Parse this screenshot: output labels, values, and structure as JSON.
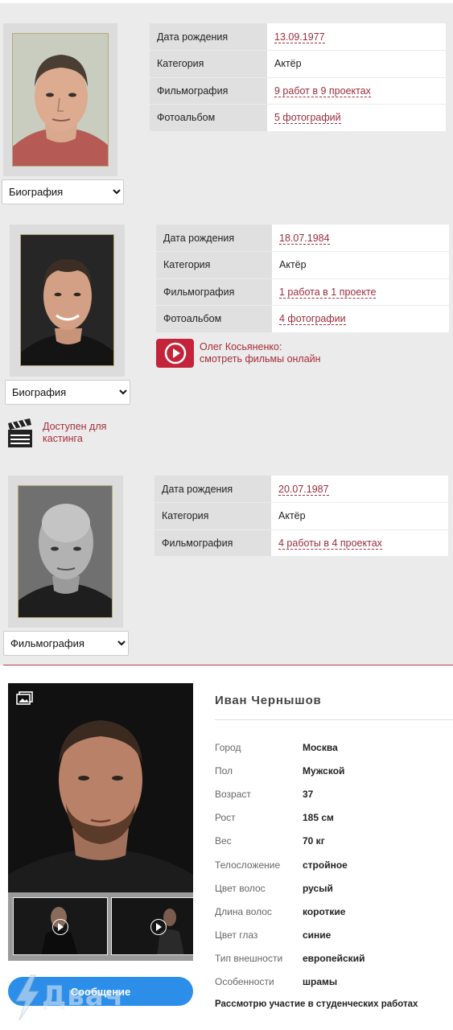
{
  "actors": [
    {
      "dropdown": "Биография",
      "rows": [
        {
          "label": "Дата рождения",
          "value": "13.09.1977",
          "link": true
        },
        {
          "label": "Категория",
          "value": "Актёр",
          "link": false
        },
        {
          "label": "Фильмография",
          "value": "9 работ в 9 проектах",
          "link": true
        },
        {
          "label": "Фотоальбом",
          "value": "5 фотографий",
          "link": true
        }
      ]
    },
    {
      "dropdown": "Биография",
      "rows": [
        {
          "label": "Дата рождения",
          "value": "18.07.1984",
          "link": true
        },
        {
          "label": "Категория",
          "value": "Актёр",
          "link": false
        },
        {
          "label": "Фильмография",
          "value": "1 работа в 1 проекте",
          "link": true
        },
        {
          "label": "Фотоальбом",
          "value": "4 фотографии",
          "link": true
        }
      ],
      "watch_line1": "Олег Косьяненко:",
      "watch_line2": "смотреть фильмы онлайн",
      "casting_line1": "Доступен для",
      "casting_line2": "кастинга"
    },
    {
      "dropdown": "Фильмография",
      "rows": [
        {
          "label": "Дата рождения",
          "value": "20.07.1987",
          "link": true
        },
        {
          "label": "Категория",
          "value": "Актёр",
          "link": false
        },
        {
          "label": "Фильмография",
          "value": "4 работы в 4 проектах",
          "link": true
        }
      ]
    }
  ],
  "profile": {
    "name": "Иван Чернышов",
    "props": [
      {
        "label": "Город",
        "value": "Москва"
      },
      {
        "label": "Пол",
        "value": "Мужской"
      },
      {
        "label": "Возраст",
        "value": "37"
      },
      {
        "label": "Рост",
        "value": "185 см"
      },
      {
        "label": "Вес",
        "value": "70 кг"
      },
      {
        "label": "Телосложение",
        "value": "стройное"
      },
      {
        "label": "Цвет волос",
        "value": "русый"
      },
      {
        "label": "Длина волос",
        "value": "короткие"
      },
      {
        "label": "Цвет глаз",
        "value": "синие"
      },
      {
        "label": "Тип внешности",
        "value": "европейский"
      },
      {
        "label": "Особенности",
        "value": "шрамы"
      }
    ],
    "student_note": "Рассмотрю участие в студенческих работах",
    "message_button": "Сообщение"
  },
  "watermark": "Двач",
  "colors": {
    "link": "#9b2b39",
    "accent_red": "#c4233a",
    "button_blue": "#2c8ee9"
  }
}
